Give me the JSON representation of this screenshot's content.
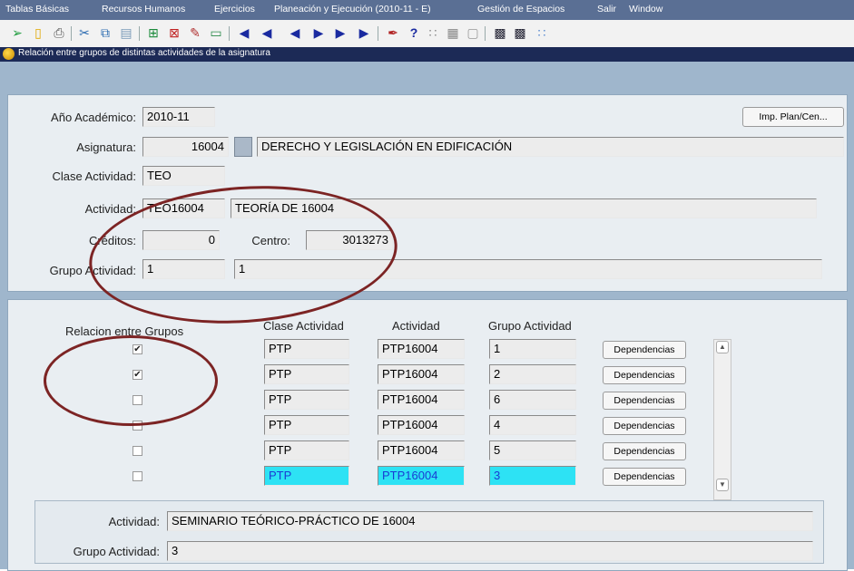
{
  "menu": [
    "Tablas Básicas",
    "Recursos Humanos",
    "Ejercicios",
    "Planeación y Ejecución  (2010-11 - E)",
    "Gestión de Espacios",
    "Salir",
    "Window"
  ],
  "window": {
    "title": "Relación entre grupos de distintas actividades de la asignatura"
  },
  "header": {
    "anio_label": "Año Académico:",
    "anio_value": "2010-11",
    "imp_button": "Imp. Plan/Cen...",
    "asignatura_label": "Asignatura:",
    "asignatura_code": "16004",
    "asignatura_name": "DERECHO Y LEGISLACIÓN EN EDIFICACIÓN",
    "clase_label": "Clase Actividad:",
    "clase_value": "TEO",
    "actividad_label": "Actividad:",
    "actividad_code": "TEO16004",
    "actividad_name": "TEORÍA DE 16004",
    "creditos_label": "Créditos:",
    "creditos_value": "0",
    "centro_label": "Centro:",
    "centro_value": "3013273",
    "grupo_label": "Grupo Actividad:",
    "grupo_value": "1",
    "grupo_desc": "1"
  },
  "table": {
    "headers": {
      "relacion": "Relacion entre Grupos",
      "clase": "Clase Actividad",
      "actividad": "Actividad",
      "grupo": "Grupo Actividad"
    },
    "dep_label": "Dependencias",
    "rows": [
      {
        "checked": true,
        "clase": "PTP",
        "actividad": "PTP16004",
        "grupo": "1"
      },
      {
        "checked": true,
        "clase": "PTP",
        "actividad": "PTP16004",
        "grupo": "2"
      },
      {
        "checked": false,
        "clase": "PTP",
        "actividad": "PTP16004",
        "grupo": "6"
      },
      {
        "checked": false,
        "clase": "PTP",
        "actividad": "PTP16004",
        "grupo": "4"
      },
      {
        "checked": false,
        "clase": "PTP",
        "actividad": "PTP16004",
        "grupo": "5"
      },
      {
        "checked": false,
        "clase": "PTP",
        "actividad": "PTP16004",
        "grupo": "3"
      }
    ],
    "selected_row": 5
  },
  "footer": {
    "actividad_label": "Actividad:",
    "actividad_value": "SEMINARIO TEÓRICO-PRÁCTICO DE 16004",
    "grupo_label": "Grupo Actividad:",
    "grupo_value": "3"
  },
  "colors": {
    "menubar": "#5a6f94",
    "titlebar": "#1c2a56",
    "highlight": "#2de2f4",
    "annotation": "#7c2424"
  },
  "toolbar_icons": [
    "exit-icon",
    "open-folder-icon",
    "print-icon",
    "cut-icon",
    "copy-icon",
    "paste-icon",
    "insert-record-icon",
    "delete-record-icon",
    "edit-icon",
    "clear-icon",
    "first-record-icon",
    "previous-set-icon",
    "previous-record-icon",
    "next-record-icon",
    "next-set-icon",
    "last-record-icon",
    "query-icon",
    "help-icon",
    "dot-icon",
    "calendar-icon",
    "disabled-icon",
    "window-icon",
    "window2-icon",
    "grid-icon"
  ]
}
